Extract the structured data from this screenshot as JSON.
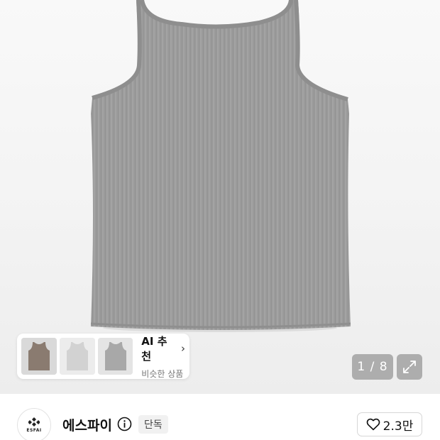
{
  "gallery": {
    "counter": "1 / 8",
    "main_image": "gray-ribbed-tank-top"
  },
  "ai_recommend": {
    "title": "AI 추천",
    "chevron": "›",
    "subtitle": "비슷한 상품",
    "thumbnails": [
      "brown-tank-top",
      "light-gray-tank-top",
      "gray-tank-top"
    ]
  },
  "brand": {
    "logo_text": "ESFAI",
    "name": "에스파이",
    "badge": "단독"
  },
  "like": {
    "count": "2.3만"
  },
  "colors": {
    "tank_gray": "#9a9a9a",
    "tank_brown": "#8a7b70",
    "tank_light": "#d6d6d6",
    "overlay": "#7f7f7f"
  }
}
